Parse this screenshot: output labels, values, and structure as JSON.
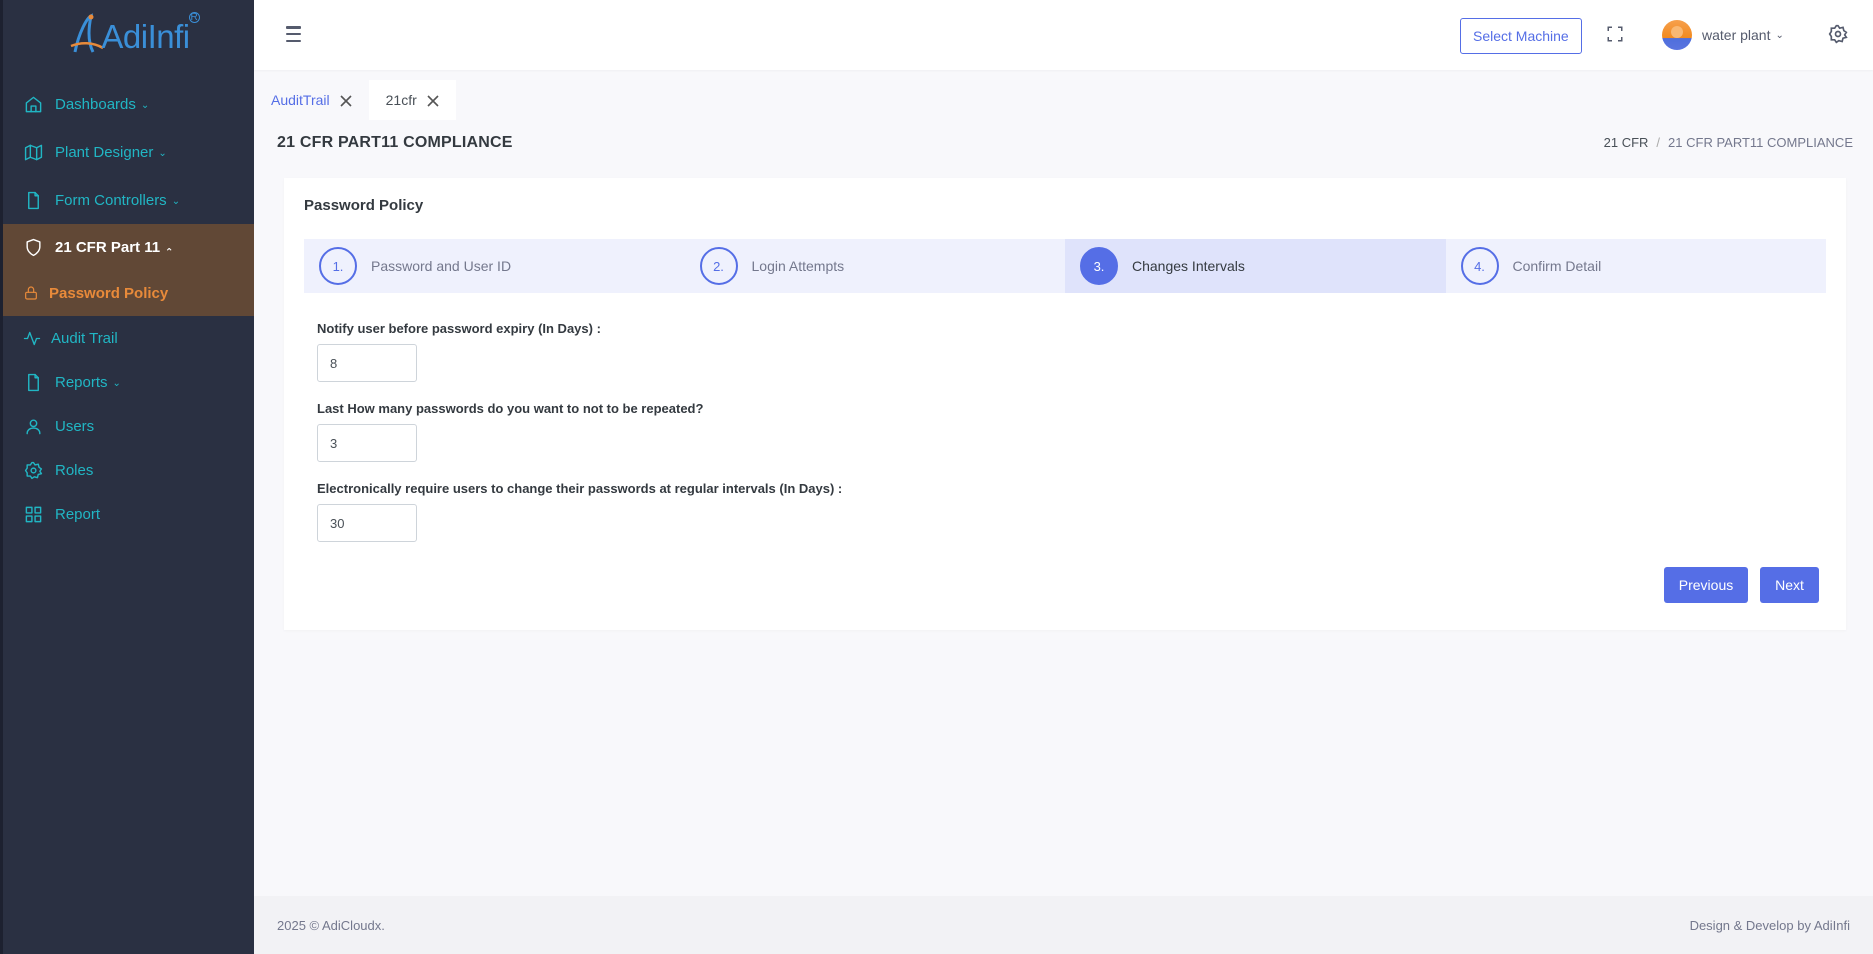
{
  "brand": {
    "name": "AdiInfi",
    "reg": "R"
  },
  "sidebar": {
    "items": [
      {
        "label": "Dashboards",
        "icon": "home-icon",
        "has_children": true
      },
      {
        "label": "Plant Designer",
        "icon": "map-icon",
        "has_children": true
      },
      {
        "label": "Form Controllers",
        "icon": "file-icon",
        "has_children": true
      },
      {
        "label": "21 CFR Part 11",
        "icon": "shield-icon",
        "expanded": true
      },
      {
        "label": "Password Policy",
        "icon": "lock-icon",
        "active": true
      },
      {
        "label": "Audit Trail",
        "icon": "activity-icon"
      },
      {
        "label": "Reports",
        "icon": "file-icon",
        "has_children": true
      },
      {
        "label": "Users",
        "icon": "user-icon"
      },
      {
        "label": "Roles",
        "icon": "gear-icon"
      },
      {
        "label": "Report",
        "icon": "grid-icon"
      }
    ]
  },
  "topbar": {
    "select_machine": "Select Machine",
    "user_name": "water plant"
  },
  "tabs": [
    {
      "label": "AuditTrail",
      "active": false
    },
    {
      "label": "21cfr",
      "active": true
    }
  ],
  "page": {
    "title": "21 CFR PART11 COMPLIANCE",
    "breadcrumb": [
      "21 CFR",
      "21 CFR PART11 COMPLIANCE"
    ]
  },
  "card": {
    "title": "Password Policy",
    "steps": [
      {
        "num": "1.",
        "label": "Password and User ID"
      },
      {
        "num": "2.",
        "label": "Login Attempts"
      },
      {
        "num": "3.",
        "label": "Changes Intervals",
        "current": true
      },
      {
        "num": "4.",
        "label": "Confirm Detail"
      }
    ],
    "fields": [
      {
        "label": "Notify user before password expiry (In Days) :",
        "value": "8"
      },
      {
        "label": "Last How many passwords do you want to not to be repeated?",
        "value": "3"
      },
      {
        "label": "Electronically require users to change their passwords at regular intervals (In Days) :",
        "value": "30"
      }
    ],
    "previous": "Previous",
    "next": "Next"
  },
  "footer": {
    "left": "2025 © AdiCloudx.",
    "right": "Design & Develop by AdiInfi"
  },
  "colors": {
    "primary": "#556ee6",
    "sidebar_bg": "#2a3042",
    "sidebar_text": "#21b6c4",
    "active_group_bg": "#614836",
    "active_child_text": "#e88a3a"
  }
}
